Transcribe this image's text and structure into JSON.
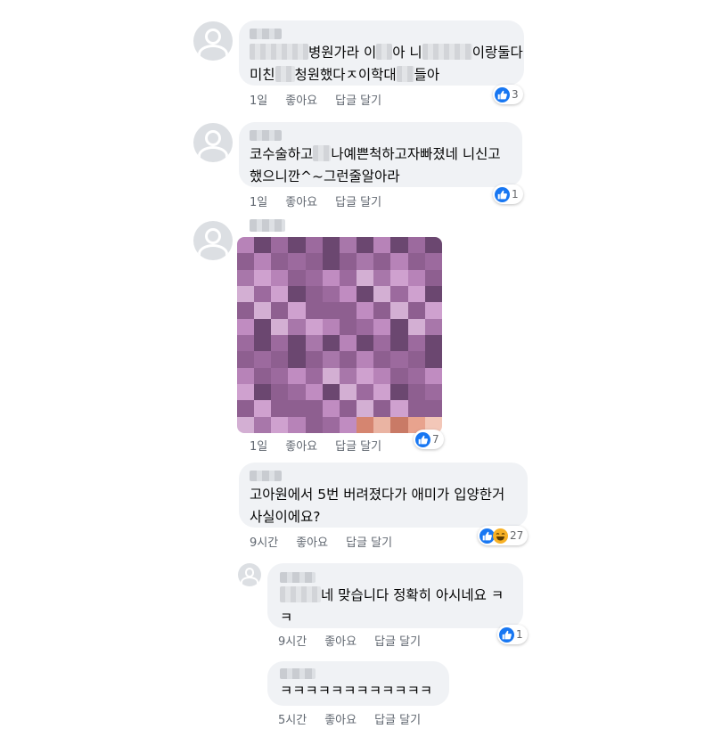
{
  "comments": [
    {
      "lines": [
        "병원가라 이",
        "아 니",
        "이랑둘다",
        "미친",
        "청원했다ㅈ이학대",
        "들아"
      ],
      "time": "1일",
      "like": "좋아요",
      "reply": "답글 달기",
      "reactions": "3"
    },
    {
      "lines": [
        "코수술하고",
        "나예쁜척하고자빠졌네 니신고",
        "했으니깐^~그런줄알아라"
      ],
      "time": "1일",
      "like": "좋아요",
      "reply": "답글 달기",
      "reactions": "1"
    },
    {
      "time": "1일",
      "like": "좋아요",
      "reply": "답글 달기",
      "reactions": "7"
    },
    {
      "lines": [
        "고아원에서 5번 버려졌다가 애미가 입양한거",
        "사실이에요?"
      ],
      "time": "9시간",
      "like": "좋아요",
      "reply": "답글 달기",
      "reactions": "27"
    },
    {
      "lines": [
        "네 맞습니다 정확히 아시네요 ㅋ",
        "ㅋ"
      ],
      "time": "9시간",
      "like": "좋아요",
      "reply": "답글 달기",
      "reactions": "1"
    },
    {
      "lines": [
        "ㅋㅋㅋㅋㅋㅋㅋㅋㅋㅋㅋㅋ"
      ],
      "time": "5시간",
      "like": "좋아요",
      "reply": "답글 달기"
    }
  ],
  "icons": {
    "like": "thumbs-up-icon",
    "haha": "laughing-face-icon",
    "avatar": "default-avatar-icon"
  },
  "colors": {
    "bubble": "#f0f2f5",
    "like_blue": "#1877f2",
    "haha_yellow": "#f7b125",
    "meta_text": "#606770",
    "mosaic_main": "#b783b8"
  }
}
